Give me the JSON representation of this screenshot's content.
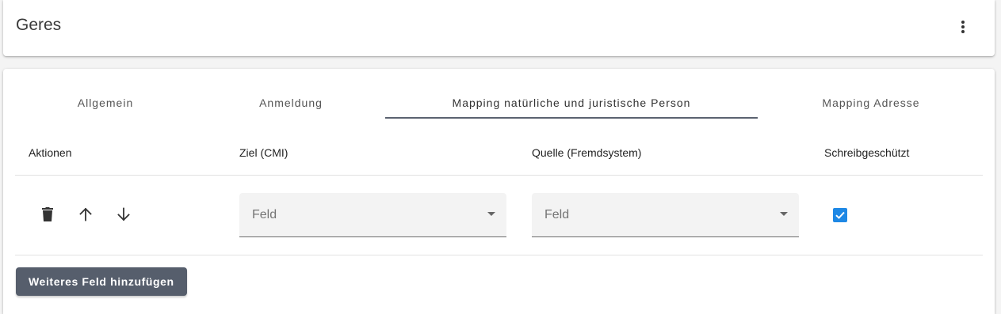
{
  "header": {
    "title": "Geres",
    "more_icon": "more-vertical-icon"
  },
  "tabs": [
    {
      "label": "Allgemein",
      "active": false
    },
    {
      "label": "Anmeldung",
      "active": false
    },
    {
      "label": "Mapping natürliche und juristische Person",
      "active": true
    },
    {
      "label": "Mapping Adresse",
      "active": false
    }
  ],
  "table": {
    "columns": [
      "Aktionen",
      "Ziel (CMI)",
      "Quelle (Fremdsystem)",
      "Schreibgeschützt"
    ],
    "rows": [
      {
        "actions": [
          "delete-icon",
          "arrow-up-icon",
          "arrow-down-icon"
        ],
        "target_placeholder": "Feld",
        "source_placeholder": "Feld",
        "readonly_checked": true
      }
    ]
  },
  "add_button_label": "Weiteres Feld hinzufügen",
  "colors": {
    "accent": "#1e88e5",
    "button": "#565e6c",
    "tab_indicator": "#5b6270"
  }
}
